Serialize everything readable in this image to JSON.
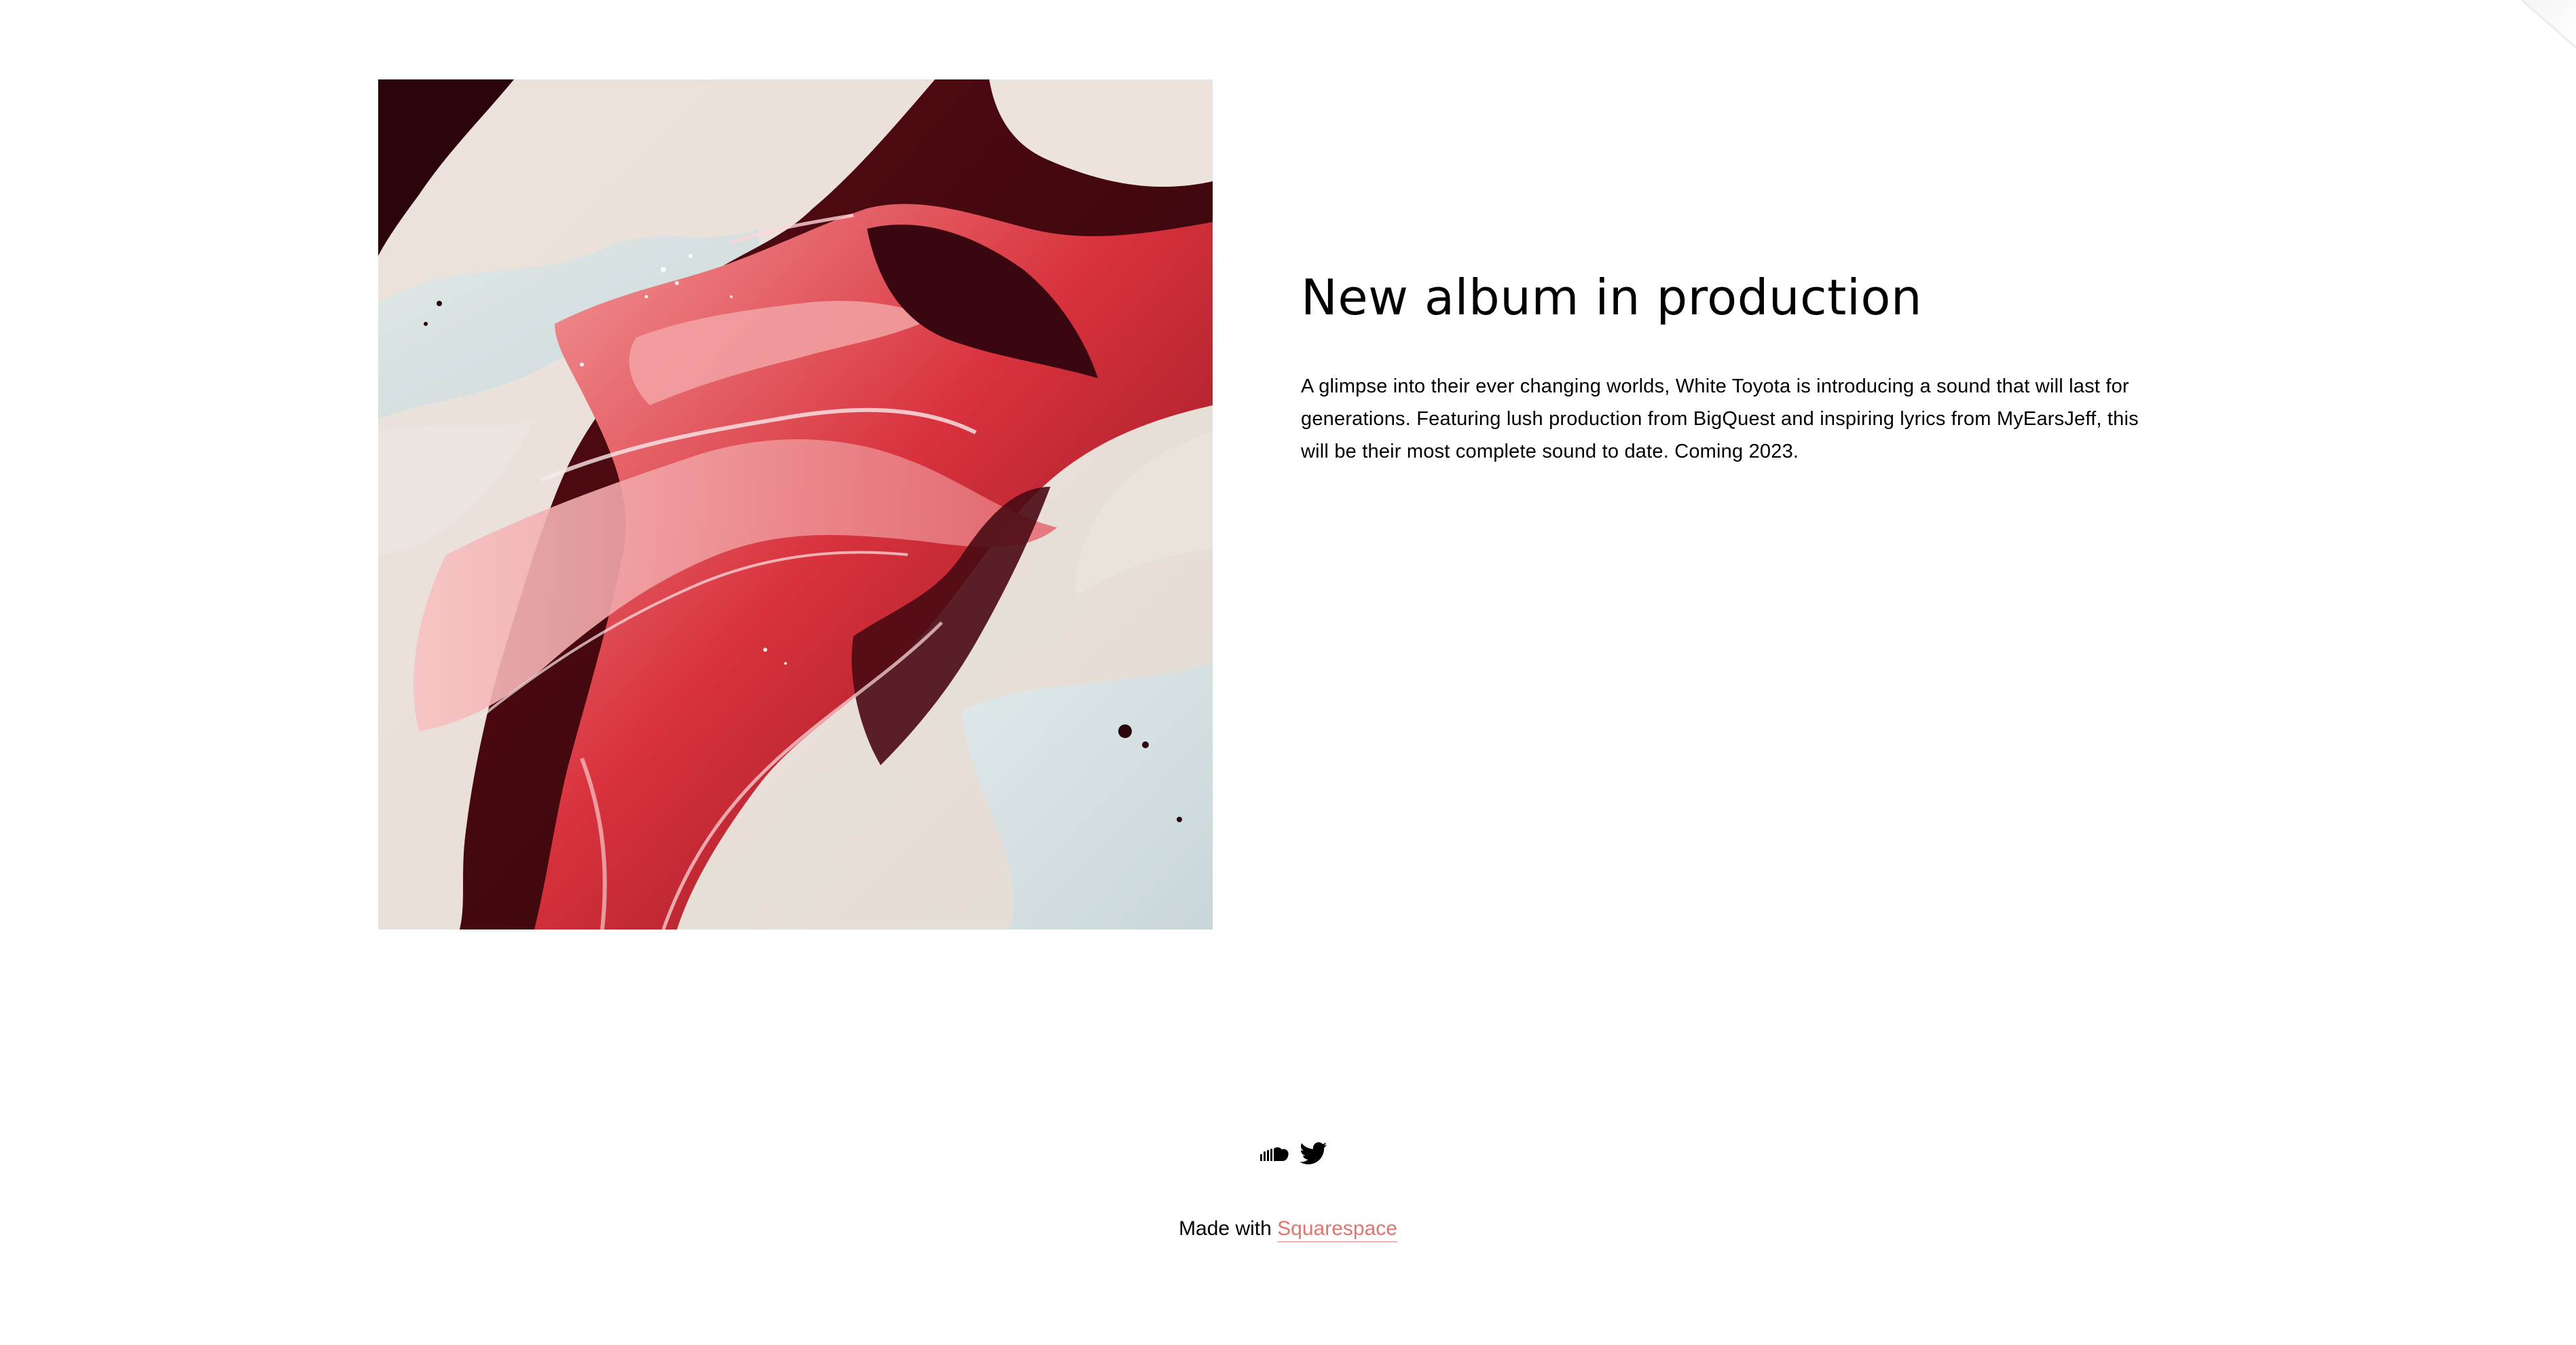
{
  "hero": {
    "image_alt": "Abstract fluid art in red, dark maroon, pink and cream tones"
  },
  "article": {
    "title": "New album in production",
    "body": "A glimpse into their ever changing worlds, White Toyota is introducing a sound that will last for generations. Featuring lush production from BigQuest and inspiring lyrics from MyEarsJeff, this will be their most complete sound to date. Coming 2023."
  },
  "social": {
    "items": [
      {
        "name": "soundcloud-icon"
      },
      {
        "name": "twitter-icon"
      }
    ]
  },
  "footer": {
    "made_with_label": "Made with",
    "brand_link": "Squarespace"
  },
  "colors": {
    "background": "#ffffff",
    "text": "#000000",
    "link_accent": "#e1756b"
  }
}
